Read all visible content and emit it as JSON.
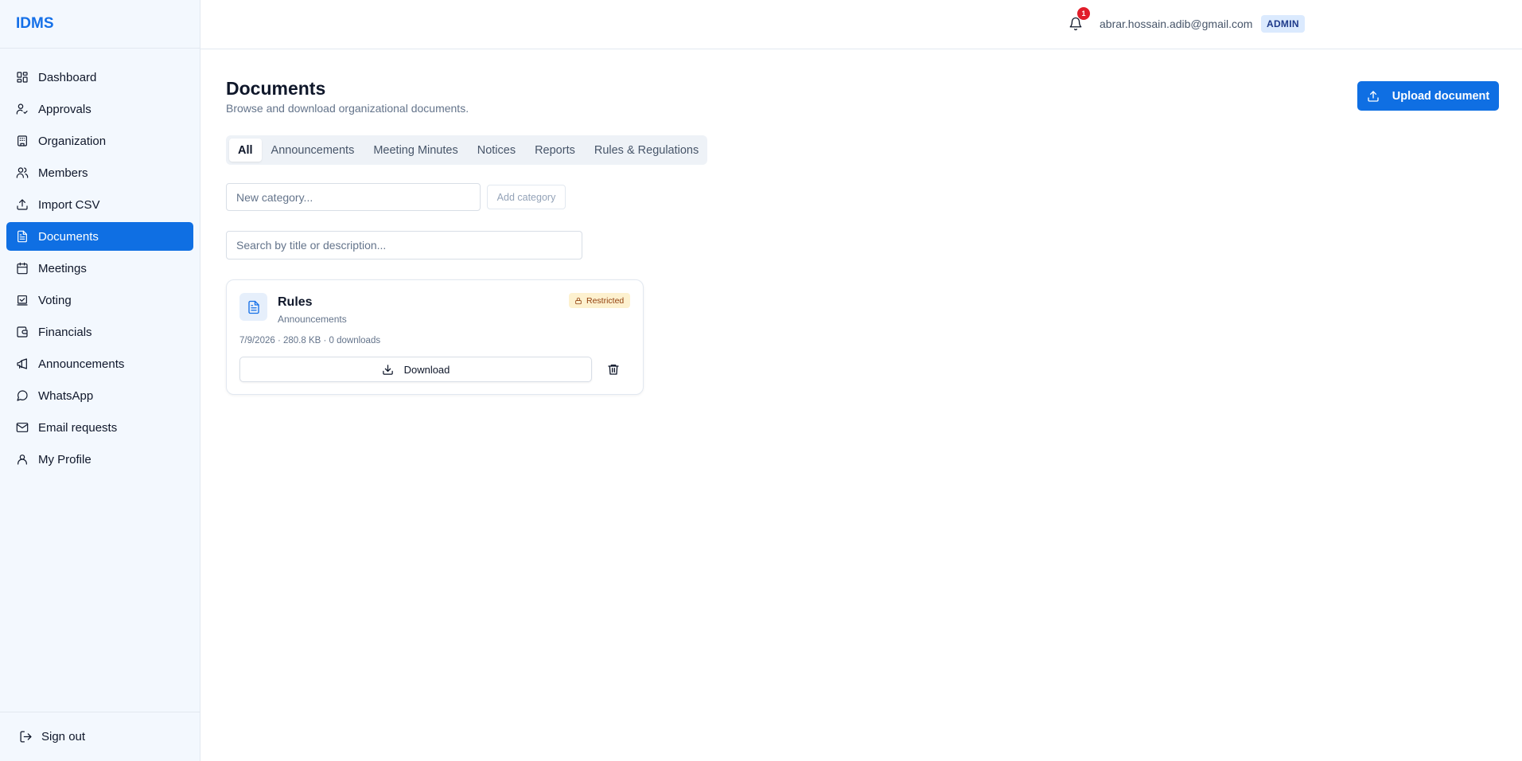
{
  "app": {
    "brand": "IDMS"
  },
  "sidebar": {
    "items": [
      {
        "label": "Dashboard",
        "icon": "dashboard-icon",
        "active": false
      },
      {
        "label": "Approvals",
        "icon": "user-check-icon",
        "active": false
      },
      {
        "label": "Organization",
        "icon": "building-icon",
        "active": false
      },
      {
        "label": "Members",
        "icon": "users-icon",
        "active": false
      },
      {
        "label": "Import CSV",
        "icon": "upload-icon",
        "active": false
      },
      {
        "label": "Documents",
        "icon": "file-text-icon",
        "active": true
      },
      {
        "label": "Meetings",
        "icon": "calendar-icon",
        "active": false
      },
      {
        "label": "Voting",
        "icon": "vote-icon",
        "active": false
      },
      {
        "label": "Financials",
        "icon": "wallet-icon",
        "active": false
      },
      {
        "label": "Announcements",
        "icon": "megaphone-icon",
        "active": false
      },
      {
        "label": "WhatsApp",
        "icon": "chat-bubble-icon",
        "active": false
      },
      {
        "label": "Email requests",
        "icon": "mail-icon",
        "active": false
      },
      {
        "label": "My Profile",
        "icon": "user-icon",
        "active": false
      }
    ],
    "signout_label": "Sign out"
  },
  "header": {
    "notification_count": "1",
    "user_email": "abrar.hossain.adib@gmail.com",
    "role": "ADMIN"
  },
  "main": {
    "title": "Documents",
    "subtitle": "Browse and download organizational documents.",
    "upload_label": "Upload document",
    "tabs": [
      {
        "label": "All",
        "active": true
      },
      {
        "label": "Announcements",
        "active": false
      },
      {
        "label": "Meeting Minutes",
        "active": false
      },
      {
        "label": "Notices",
        "active": false
      },
      {
        "label": "Reports",
        "active": false
      },
      {
        "label": "Rules & Regulations",
        "active": false
      }
    ],
    "new_category_placeholder": "New category...",
    "add_category_label": "Add category",
    "search_placeholder": "Search by title or description...",
    "documents": [
      {
        "title": "Rules",
        "category": "Announcements",
        "badge": "Restricted",
        "meta": "7/9/2026 · 280.8 KB · 0 downloads",
        "download_label": "Download"
      }
    ]
  },
  "colors": {
    "accent": "#0f6fe3",
    "sidebar_bg": "#f3f8fe",
    "restricted_bg": "#fdf1cf",
    "notification_badge": "#e11d2a"
  }
}
